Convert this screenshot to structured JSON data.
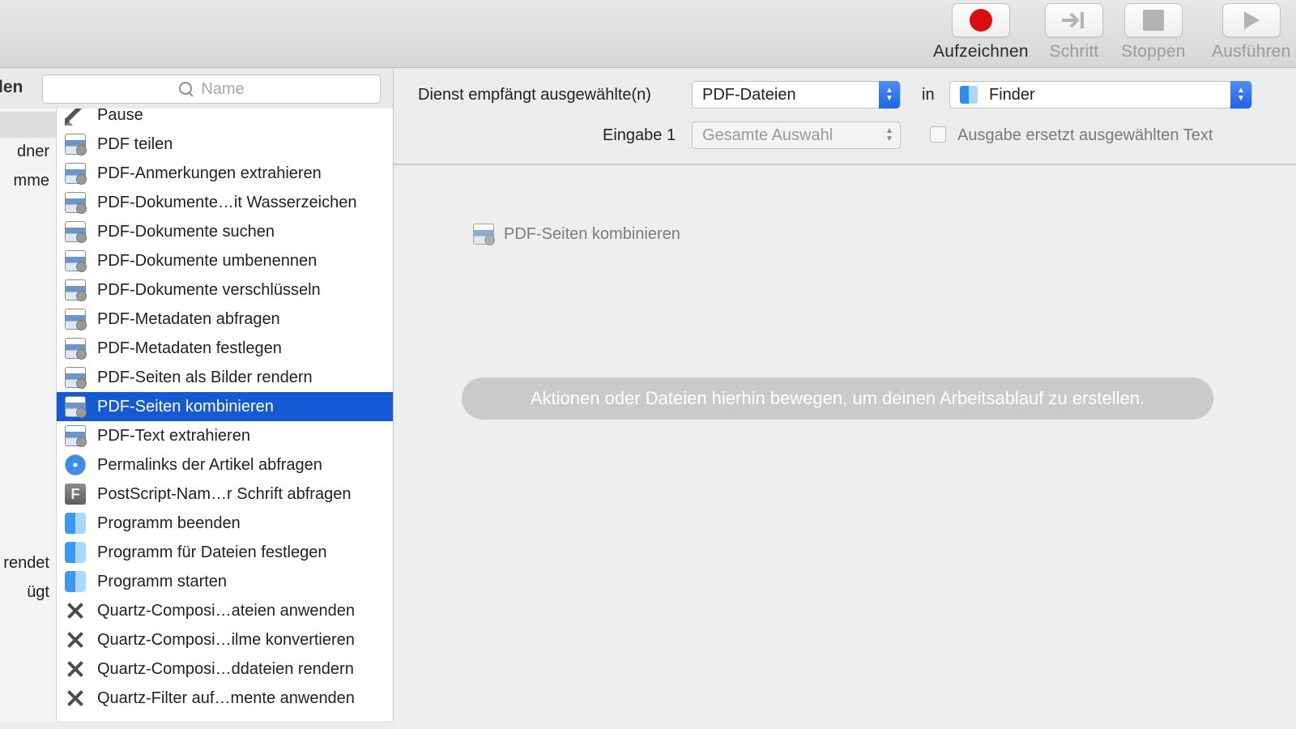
{
  "toolbar": {
    "record": "Aufzeichnen",
    "step": "Schritt",
    "stop": "Stoppen",
    "run": "Ausführen"
  },
  "library": {
    "header_label": "len",
    "search_placeholder": "Name",
    "categories": [
      "dner",
      "mme",
      "rendet",
      "ügt"
    ],
    "actions": [
      {
        "label": "Pause",
        "icon": "pause-icon"
      },
      {
        "label": "PDF teilen",
        "icon": "pdf-action-icon"
      },
      {
        "label": "PDF-Anmerkungen extrahieren",
        "icon": "pdf-action-icon"
      },
      {
        "label": "PDF-Dokumente…it Wasserzeichen",
        "icon": "pdf-action-icon"
      },
      {
        "label": "PDF-Dokumente suchen",
        "icon": "pdf-action-icon"
      },
      {
        "label": "PDF-Dokumente umbenennen",
        "icon": "pdf-action-icon"
      },
      {
        "label": "PDF-Dokumente verschlüsseln",
        "icon": "pdf-action-icon"
      },
      {
        "label": "PDF-Metadaten abfragen",
        "icon": "pdf-action-icon"
      },
      {
        "label": "PDF-Metadaten festlegen",
        "icon": "pdf-action-icon"
      },
      {
        "label": "PDF-Seiten als Bilder rendern",
        "icon": "pdf-action-icon"
      },
      {
        "label": "PDF-Seiten kombinieren",
        "icon": "pdf-action-icon",
        "selected": true
      },
      {
        "label": "PDF-Text extrahieren",
        "icon": "pdf-action-icon"
      },
      {
        "label": "Permalinks der Artikel abfragen",
        "icon": "safari-icon"
      },
      {
        "label": "PostScript-Nam…r Schrift abfragen",
        "icon": "font-book-icon"
      },
      {
        "label": "Programm beenden",
        "icon": "finder-icon"
      },
      {
        "label": "Programm für Dateien festlegen",
        "icon": "finder-icon"
      },
      {
        "label": "Programm starten",
        "icon": "finder-icon"
      },
      {
        "label": "Quartz-Composi…ateien anwenden",
        "icon": "quartz-icon"
      },
      {
        "label": "Quartz-Composi…ilme konvertieren",
        "icon": "quartz-icon"
      },
      {
        "label": "Quartz-Composi…ddateien rendern",
        "icon": "quartz-icon"
      },
      {
        "label": "Quartz-Filter auf…mente anwenden",
        "icon": "quartz-icon"
      }
    ]
  },
  "service_config": {
    "receives_label": "Dienst empfängt ausgewählte(n)",
    "receives_value": "PDF-Dateien",
    "in_label": "in",
    "app_value": "Finder",
    "input_label": "Eingabe 1",
    "input_value": "Gesamte Auswahl",
    "replace_label": "Ausgabe ersetzt ausgewählten Text",
    "replace_checked": false
  },
  "workflow": {
    "dragging_item": "PDF-Seiten kombinieren",
    "empty_hint": "Aktionen oder Dateien hierhin bewegen, um deinen Arbeitsablauf zu erstellen."
  },
  "colors": {
    "selection": "#1659d6",
    "record": "#d90f0f"
  }
}
